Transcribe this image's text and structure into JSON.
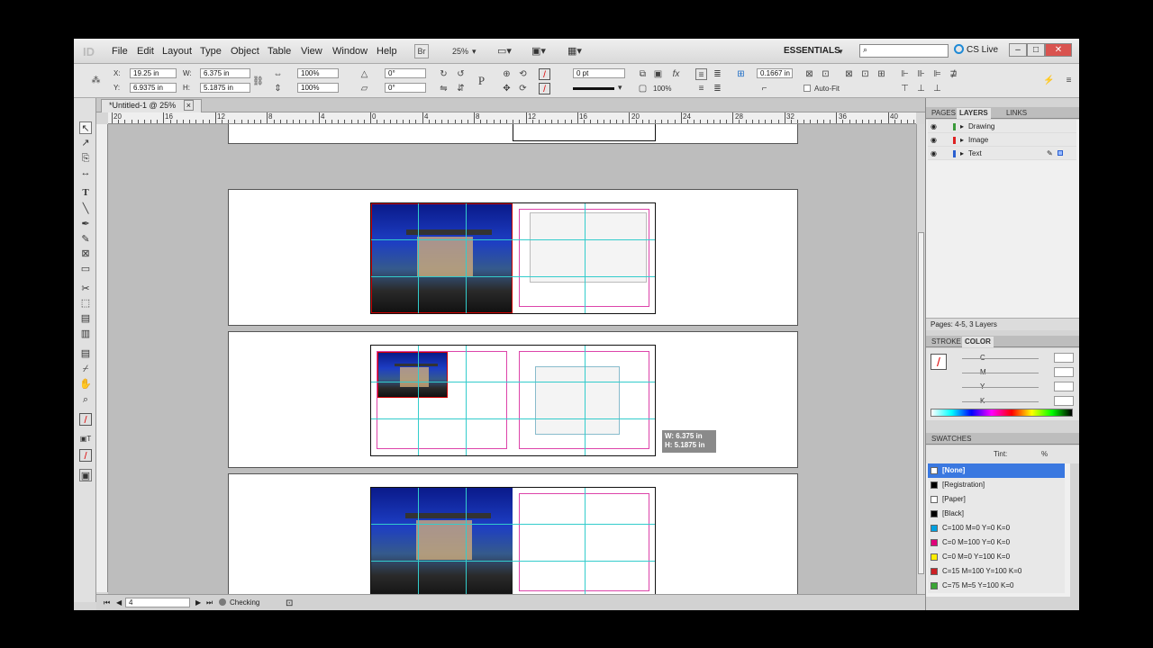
{
  "app": {
    "logo": "ID"
  },
  "menu": [
    "File",
    "Edit",
    "Layout",
    "Type",
    "Object",
    "Table",
    "View",
    "Window",
    "Help"
  ],
  "bridge_label": "Br",
  "zoom": "25%",
  "workspace": "ESSENTIALS",
  "cs_live": "CS Live",
  "control": {
    "x_label": "X:",
    "x_value": "19.25 in",
    "y_label": "Y:",
    "y_value": "6.9375 in",
    "w_label": "W:",
    "w_value": "6.375 in",
    "h_label": "H:",
    "h_value": "5.1875 in",
    "scale_x": "100%",
    "scale_y": "100%",
    "rotate": "0°",
    "shear": "0°",
    "stroke_weight": "0 pt",
    "opacity": "100%",
    "offset": "0.1667 in",
    "autofit": "Auto-Fit"
  },
  "document_tab": "*Untitled-1 @ 25%",
  "ruler_ticks": [
    "20",
    "16",
    "12",
    "8",
    "4",
    "0",
    "4",
    "8",
    "12",
    "16",
    "20",
    "24",
    "28",
    "32",
    "36",
    "40"
  ],
  "tooltip": {
    "w": "W: 6.375 in",
    "h": "H: 5.1875 in"
  },
  "status": {
    "page": "4",
    "preflight": "Checking"
  },
  "panels": {
    "tabs": [
      "PAGES",
      "LAYERS",
      "LINKS"
    ],
    "layers": [
      "Drawing",
      "Image",
      "Text"
    ],
    "layers_footer": "Pages: 4-5, 3 Layers",
    "color_tabs": [
      "STROKE",
      "COLOR"
    ],
    "color_channels": [
      "C",
      "M",
      "Y",
      "K"
    ],
    "swatches_title": "SWATCHES",
    "tint_label": "Tint:",
    "tint_unit": "%",
    "swatches": [
      {
        "name": "[None]",
        "color": "#ffffff"
      },
      {
        "name": "[Registration]",
        "color": "#000000"
      },
      {
        "name": "[Paper]",
        "color": "#ffffff"
      },
      {
        "name": "[Black]",
        "color": "#000000"
      },
      {
        "name": "C=100 M=0 Y=0 K=0",
        "color": "#00a0e0"
      },
      {
        "name": "C=0 M=100 Y=0 K=0",
        "color": "#e0007a"
      },
      {
        "name": "C=0 M=0 Y=100 K=0",
        "color": "#ffee00"
      },
      {
        "name": "C=15 M=100 Y=100 K=0",
        "color": "#cc1f24"
      },
      {
        "name": "C=75 M=5 Y=100 K=0",
        "color": "#3aa535"
      }
    ]
  }
}
